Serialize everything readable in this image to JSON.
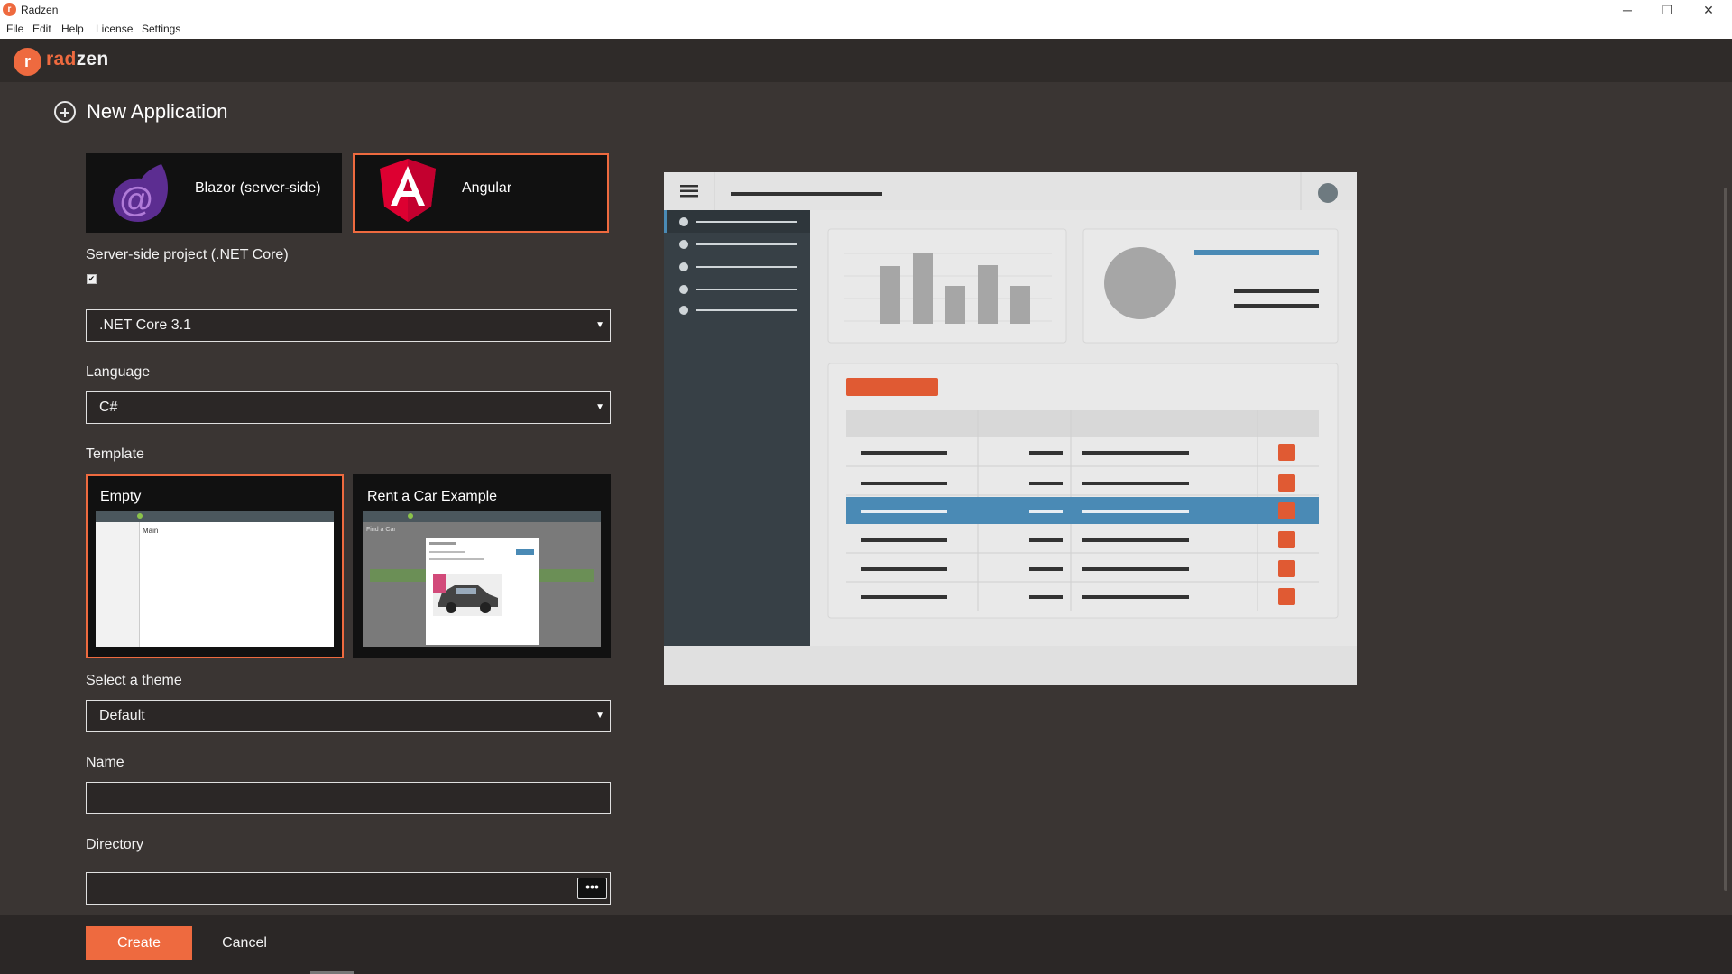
{
  "window": {
    "title": "Radzen",
    "minimize_glyph": "─",
    "restore_glyph": "❐",
    "close_glyph": "✕"
  },
  "menu": [
    "File",
    "Edit",
    "Help",
    "License",
    "Settings"
  ],
  "header": {
    "logo_text_a": "rad",
    "logo_text_b": "zen"
  },
  "page": {
    "title": "New Application"
  },
  "frameworks": [
    {
      "label": "Blazor (server-side)",
      "icon": "blazor-icon",
      "selected": false
    },
    {
      "label": "Angular",
      "icon": "angular-icon",
      "selected": true
    }
  ],
  "server_side": {
    "label": "Server-side project (.NET Core)",
    "checked": true,
    "check_glyph": "✔"
  },
  "dotnet_select": {
    "value": ".NET Core 3.1"
  },
  "language": {
    "label": "Language",
    "value": "C#"
  },
  "template": {
    "label": "Template",
    "items": [
      {
        "label": "Empty",
        "selected": true,
        "thumb_text": "Main"
      },
      {
        "label": "Rent a Car Example",
        "selected": false,
        "thumb_text": "Find a Car"
      }
    ]
  },
  "theme": {
    "label": "Select a theme",
    "value": "Default"
  },
  "name_field": {
    "label": "Name",
    "value": ""
  },
  "directory_field": {
    "label": "Directory",
    "value": "",
    "browse_label": "•••"
  },
  "footer": {
    "create_label": "Create",
    "cancel_label": "Cancel"
  },
  "colors": {
    "accent": "#ee6a3f",
    "background": "#3a3533",
    "header": "#2f2b29",
    "preview_blue": "#4a8ab5"
  },
  "select_arrow": "▼"
}
